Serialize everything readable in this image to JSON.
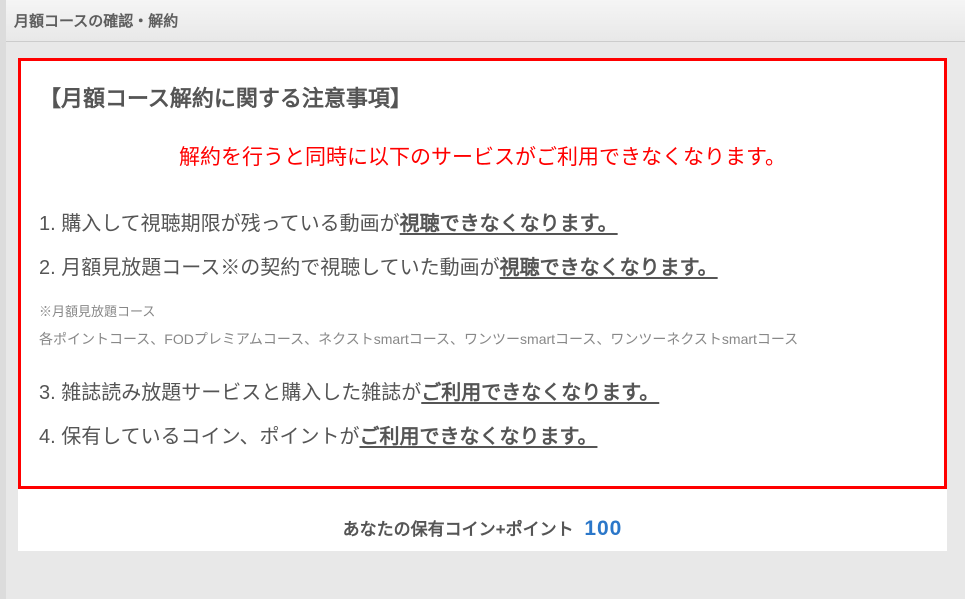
{
  "header": {
    "title": "月額コースの確認・解約"
  },
  "notice": {
    "heading": "【月額コース解約に関する注意事項】",
    "warning": "解約を行うと同時に以下のサービスがご利用できなくなります。",
    "items": [
      {
        "num": "1.",
        "normal": "購入して視聴期限が残っている動画が",
        "emph": "視聴できなくなります。"
      },
      {
        "num": "2.",
        "normal": "月額見放題コース※の契約で視聴していた動画が",
        "emph": "視聴できなくなります。"
      },
      {
        "num": "3.",
        "normal": "雑誌読み放題サービスと購入した雑誌が",
        "emph": "ご利用できなくなります。"
      },
      {
        "num": "4.",
        "normal": "保有しているコイン、ポイントが",
        "emph": "ご利用できなくなります。"
      }
    ],
    "note_title": "※月額見放題コース",
    "note_body": "各ポイントコース、FODプレミアムコース、ネクストsmartコース、ワンツーsmartコース、ワンツーネクストsmartコース"
  },
  "balance": {
    "label": "あなたの保有コイン+ポイント",
    "value": "100"
  }
}
